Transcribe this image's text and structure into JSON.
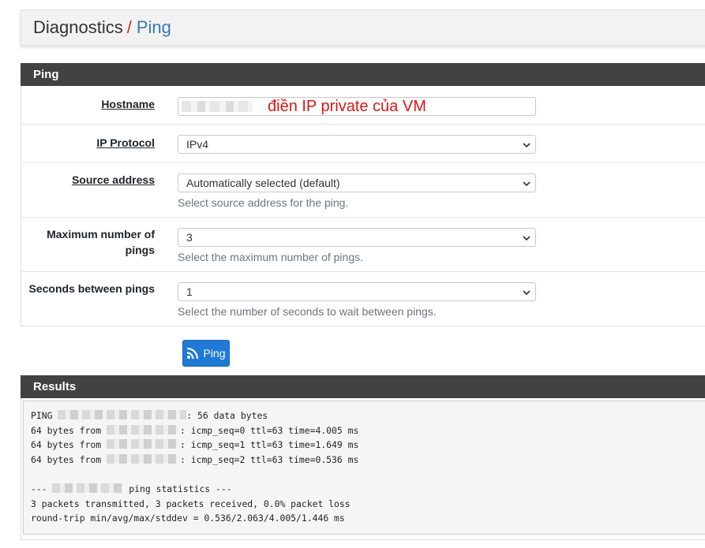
{
  "breadcrumb": {
    "section": "Diagnostics",
    "separator": "/",
    "page": "Ping"
  },
  "ping_panel": {
    "heading": "Ping",
    "hostname": {
      "label": "Hostname",
      "value": "",
      "annotation": "điền IP private của VM"
    },
    "ip_protocol": {
      "label": "IP Protocol",
      "value": "IPv4"
    },
    "source_address": {
      "label": "Source address",
      "value": "Automatically selected (default)",
      "help": "Select source address for the ping."
    },
    "max_pings": {
      "label": "Maximum number of pings",
      "value": "3",
      "help": "Select the maximum number of pings."
    },
    "seconds_between": {
      "label": "Seconds between pings",
      "value": "1",
      "help": "Select the number of seconds to wait between pings."
    },
    "ping_button": "Ping"
  },
  "results": {
    "heading": "Results",
    "lines": [
      {
        "prefix": "PING ",
        "suffix": ": 56 data bytes"
      },
      {
        "prefix": "64 bytes from ",
        "suffix": ": icmp_seq=0 ttl=63 time=4.005 ms"
      },
      {
        "prefix": "64 bytes from ",
        "suffix": ": icmp_seq=1 ttl=63 time=1.649 ms"
      },
      {
        "prefix": "64 bytes from ",
        "suffix": ": icmp_seq=2 ttl=63 time=0.536 ms"
      },
      {
        "prefix": "--- ",
        "suffix": " ping statistics ---"
      },
      {
        "text": "3 packets transmitted, 3 packets received, 0.0% packet loss"
      },
      {
        "text": "round-trip min/avg/max/stddev = 0.536/2.063/4.005/1.446 ms"
      }
    ]
  },
  "colors": {
    "panel_heading": "#424242",
    "primary_button": "#1e7ad6",
    "breadcrumb_link": "#337ab7",
    "breadcrumb_separator": "#c9302c",
    "annotation": "#e01414"
  },
  "icons": {
    "select_arrow": "chevron-down-icon",
    "ping_button": "rss-icon"
  }
}
